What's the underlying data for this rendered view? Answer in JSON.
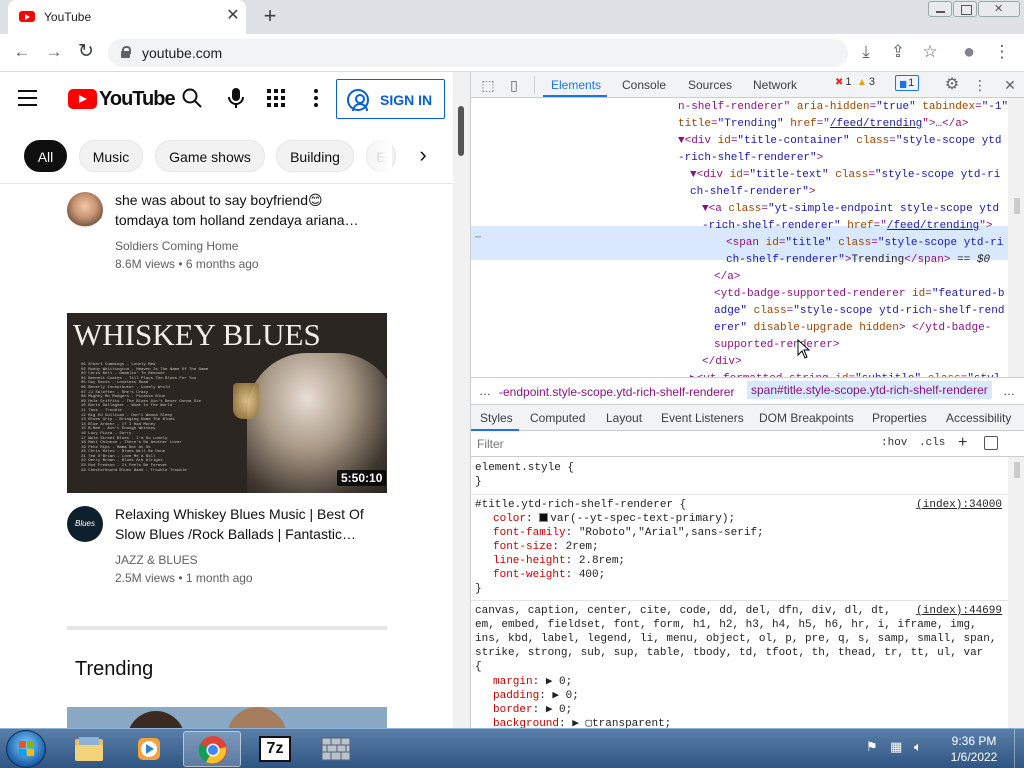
{
  "browser": {
    "tab_title": "YouTube",
    "tab_close_icon": "✕",
    "new_tab_icon": "+",
    "url": "youtube.com",
    "nav": {
      "back": "←",
      "forward": "→",
      "reload": "↻"
    },
    "toolbar_icons": {
      "install": "⤓",
      "share": "⇪",
      "bookmark": "☆",
      "profile": "●",
      "menu": "⋮"
    }
  },
  "youtube": {
    "logo_text": "YouTube",
    "sign_in_label": "SIGN IN",
    "chips": [
      "All",
      "Music",
      "Game shows",
      "Building",
      "E"
    ],
    "chip_next_icon": "›",
    "videos": [
      {
        "title_line1": "she was about to say boyfriend😊",
        "title_line2": "tomdaya tom holland zendaya ariana…",
        "channel": "Soldiers Coming Home",
        "meta": "8.6M views • 6 months ago"
      },
      {
        "thumb_title": "WHISKEY BLUES",
        "thumb_tracklist": "01 Albert Cummings - Lonely Bed\n02 Buddy Whittington - Heaven Is The Name Of The Game\n03 Chris Bell - Gamblin' To Recover\n04 Bennett Coates - Till Plays The Blues For You\n05 Guy Davis - Loveless Road\n06 Beverly Inchorbuter - Lonely Wrold\n07 JJ Salofter - She's Crazy\n08 Mighty Mo Rodgers - Picasso Blue\n09 Hole Griffits - The Blues Ain't Never Gonna Die\n10 Boris Gallagher - What In The World\n11 Tass - Trouble\n12 Big Ed Sullivan - Don't Wanna Sleep\n13 Blues Grip - Bringing Home The Blues\n14 Blue Ardeer - If I Had Money\n15 B-Nee - Ain't Enough Whiskey\n16 Lucy Pizza - Sorry\n17 Wale Street Blues - I'm So Lonely\n18 Matt Chinese - There's No Another Lover\n19 Pete Rips - Mama Not At Ok\n20 Chris Miles - Blues Will Be Done\n21 Ted O'Brian - Love Me A Bill\n22 Gerry Brown - Blues Are Alright\n23 Rod Fredson - It Feels Be Forever\n24 Chesterhound Blues Band - Trouble Trouble",
        "duration": "5:50:10",
        "channel_avatar_text": "Blues",
        "title_line1": "Relaxing Whiskey Blues Music | Best Of",
        "title_line2": "Slow Blues /Rock Ballads | Fantastic…",
        "channel": "JAZZ & BLUES",
        "meta": "2.5M views • 1 month ago"
      }
    ],
    "section_title": "Trending"
  },
  "devtools": {
    "tabs": [
      "Elements",
      "Console",
      "Sources",
      "Network"
    ],
    "badges": {
      "errors": "1",
      "warnings": "3",
      "messages": "1"
    },
    "icons": {
      "inspect": "⬚",
      "device": "▯",
      "settings": "⚙",
      "more": "⋮",
      "close": "✕"
    },
    "dom_lines": [
      {
        "indent": 207,
        "html": "<span class=\"tag\">n-shelf-renderer\"</span> <span class=\"attr\">aria-hidden</span>=<span class=\"val\">\"true\"</span> <span class=\"attr\">tabindex</span>=<span class=\"val\">\"-1\"</span>"
      },
      {
        "indent": 207,
        "html": "<span class=\"attr\">title</span>=<span class=\"val\">\"Trending\"</span> <span class=\"attr\">href</span>=\"<span class=\"link\">/feed/trending</span>\"&gt;…&lt;/a&gt;"
      },
      {
        "indent": 207,
        "html": "▼&lt;div <span class=\"attr\">id</span>=<span class=\"val\">\"title-container\"</span> <span class=\"attr\">class</span>=<span class=\"val\">\"style-scope ytd</span>"
      },
      {
        "indent": 207,
        "html": "<span class=\"val\">-rich-shelf-renderer\"</span>&gt;"
      },
      {
        "indent": 219,
        "html": "▼&lt;div <span class=\"attr\">id</span>=<span class=\"val\">\"title-text\"</span> <span class=\"attr\">class</span>=<span class=\"val\">\"style-scope ytd-ri</span>"
      },
      {
        "indent": 219,
        "html": "<span class=\"val\">ch-shelf-renderer\"</span>&gt;"
      },
      {
        "indent": 231,
        "html": "▼&lt;a <span class=\"attr\">class</span>=<span class=\"val\">\"yt-simple-endpoint style-scope ytd</span>"
      },
      {
        "indent": 231,
        "html": "<span class=\"val\">-rich-shelf-renderer\"</span> <span class=\"attr\">href</span>=\"<span class=\"link\">/feed/trending</span>\"&gt;"
      },
      {
        "indent": 255,
        "html": "&lt;span <span class=\"attr\">id</span>=<span class=\"val\">\"title\"</span> <span class=\"attr\">class</span>=<span class=\"val\">\"style-scope ytd-ri</span>"
      },
      {
        "indent": 255,
        "html": "<span class=\"val\">ch-shelf-renderer\"</span>&gt;<span class=\"txt\">Trending</span>&lt;/span&gt; <span class=\"txt\"><i>== $0</i></span>"
      },
      {
        "indent": 243,
        "html": "&lt;/a&gt;"
      },
      {
        "indent": 243,
        "html": "&lt;ytd-badge-supported-renderer <span class=\"attr\">id</span>=<span class=\"val\">\"featured-b</span>"
      },
      {
        "indent": 243,
        "html": "<span class=\"val\">adge\"</span> <span class=\"attr\">class</span>=<span class=\"val\">\"style-scope ytd-rich-shelf-rend</span>"
      },
      {
        "indent": 243,
        "html": "<span class=\"val\">erer\"</span> <span class=\"attr\">disable-upgrade hidden</span>&gt; &lt;/ytd-badge-"
      },
      {
        "indent": 243,
        "html": "supported-renderer&gt;"
      },
      {
        "indent": 231,
        "html": "&lt;/div&gt;"
      },
      {
        "indent": 219,
        "html": "▶&lt;yt-formatted-string <span class=\"attr\">id</span>=<span class=\"val\">\"subtitle\"</span> <span class=\"attr\">class</span>=<span class=\"val\">\"styl</span>"
      }
    ],
    "crumbs": {
      "more": "…",
      "left": "-endpoint.style-scope.ytd-rich-shelf-renderer",
      "right": "span#title.style-scope.ytd-rich-shelf-renderer",
      "overflow": "…"
    },
    "subtabs": [
      "Styles",
      "Computed",
      "Layout",
      "Event Listeners",
      "DOM Breakpoints",
      "Properties",
      "Accessibility"
    ],
    "filter_placeholder": "Filter",
    "hov": ":hov",
    "cls": ".cls",
    "add_rule": "+",
    "styles": {
      "element_style": "element.style {",
      "close_brace": "}",
      "rule1_selector": "#title.ytd-rich-shelf-renderer {",
      "rule1_source": "(index):34000",
      "rule1_props": [
        {
          "name": "color",
          "value": "var(--yt-spec-text-primary);"
        },
        {
          "name": "font-family",
          "value": "\"Roboto\",\"Arial\",sans-serif;"
        },
        {
          "name": "font-size",
          "value": "2rem;"
        },
        {
          "name": "line-height",
          "value": "2.8rem;"
        },
        {
          "name": "font-weight",
          "value": "400;"
        }
      ],
      "rule2_source": "(index):44699",
      "rule2_selector_lines": [
        "canvas, caption, center, cite, code, dd, del, dfn, div, dl, dt,",
        "em, embed, fieldset, font, form, h1, h2, h3, h4, h5, h6, hr, i, iframe, img,",
        "ins, kbd, label, legend, li, menu, object, ol, p, pre, q, s, samp, small, span,",
        "strike, strong, sub, sup, table, tbody, td, tfoot, th, thead, tr, tt, ul, var",
        "{"
      ],
      "rule2_props": [
        {
          "name": "margin",
          "value": "▶ 0;"
        },
        {
          "name": "padding",
          "value": "▶ 0;"
        },
        {
          "name": "border",
          "value": "▶ 0;"
        },
        {
          "name": "background",
          "value": "▶ ▢transparent;"
        }
      ]
    }
  },
  "taskbar": {
    "apps": [
      "Windows Explorer",
      "Windows Media Player",
      "Google Chrome",
      "7-Zip",
      "Windows Firewall"
    ],
    "time": "9:36 PM",
    "date": "1/6/2022",
    "accent": "#2f5583"
  }
}
